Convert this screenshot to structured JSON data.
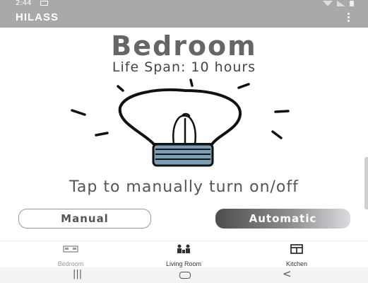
{
  "status_bar": {
    "time": "2:44"
  },
  "app_bar": {
    "title": "HILASS"
  },
  "room": {
    "title": "Bedroom",
    "life_span": "Life Span: 10 hours"
  },
  "hint": "Tap to manually turn on/off",
  "buttons": {
    "manual": "Manual",
    "automatic": "Automatic"
  },
  "bottom_nav": {
    "items": [
      {
        "label": "Bedroom",
        "icon": "bed-icon",
        "active": true
      },
      {
        "label": "Living Room",
        "icon": "people-icon",
        "active": false
      },
      {
        "label": "Kitchen",
        "icon": "kitchen-icon",
        "active": false
      }
    ]
  },
  "system_nav": {
    "recent": "|||",
    "back": "<"
  },
  "colors": {
    "app_bar": "#a9a9a9",
    "automatic_dark": "#4e4e50",
    "bulb_base": "#7a9eb3"
  }
}
